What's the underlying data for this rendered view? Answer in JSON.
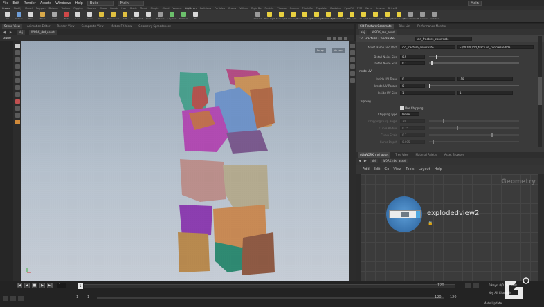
{
  "menu": {
    "items": [
      "File",
      "Edit",
      "Render",
      "Assets",
      "Windows",
      "Help"
    ],
    "desktop": "Build",
    "network": "Main",
    "right_label": "Main"
  },
  "shelf_tabs": [
    "Create",
    "Modify",
    "Model",
    "Polygon",
    "Deform",
    "Texture",
    "Rigging",
    "Muscles",
    "Chara",
    "Constr",
    "Hair",
    "Guide",
    "Terrai",
    "Simple",
    "Cloud",
    "Volume",
    "Lights an",
    "Collisions",
    "Particles",
    "Grains",
    "Vellum",
    "Rigid Bo",
    "Particle",
    "Viscous",
    "Oceans",
    "Flush Co",
    "Populate",
    "Containe",
    "Pyro FX",
    "FEM",
    "Wires",
    "Crowds",
    "Drive Si"
  ],
  "shelf_tools": [
    {
      "label": "Box",
      "color": "#d8d8d8"
    },
    {
      "label": "Sphere",
      "color": "#6f9ed8"
    },
    {
      "label": "Tube",
      "color": "#d8d8d8"
    },
    {
      "label": "Torus",
      "color": "#d9a94a"
    },
    {
      "label": "Grid",
      "color": "#a8a8a8"
    },
    {
      "label": "Null",
      "color": "#d04848"
    },
    {
      "label": "Line",
      "color": "#d8d8d8"
    },
    {
      "label": "Circle",
      "color": "#d8d8d8"
    },
    {
      "label": "Curve",
      "color": "#e0c040"
    },
    {
      "label": "Draw Curve",
      "color": "#e0c040"
    },
    {
      "label": "Path",
      "color": "#e0c040"
    },
    {
      "label": "Spray Paint",
      "color": "#d8d8d8"
    },
    {
      "label": "Font",
      "color": "#d8d8d8"
    },
    {
      "label": "Platonic",
      "color": "#9a9a9a"
    },
    {
      "label": "L-System",
      "color": "#6cc06c"
    },
    {
      "label": "Metaball",
      "color": "#6cc06c"
    },
    {
      "label": "File",
      "color": "#d8d8d8"
    }
  ],
  "light_tools": [
    {
      "label": "Camera",
      "color": "#9a9a9a"
    },
    {
      "label": "Point Light",
      "color": "#e8d040"
    },
    {
      "label": "Spot Light",
      "color": "#e8d040"
    },
    {
      "label": "Area Light",
      "color": "#e8d040"
    },
    {
      "label": "Geometry Light",
      "color": "#e8d040"
    },
    {
      "label": "Volume Light",
      "color": "#e8d040"
    },
    {
      "label": "Distant Light",
      "color": "#e8d040"
    },
    {
      "label": "Environment Light",
      "color": "#e8d040"
    },
    {
      "label": "Sky Light",
      "color": "#e8d040"
    },
    {
      "label": "GI Light",
      "color": "#e8d040"
    },
    {
      "label": "Caustic Light",
      "color": "#e8d040"
    },
    {
      "label": "Portal Light",
      "color": "#e8d040"
    },
    {
      "label": "Ambient Light",
      "color": "#e8d040"
    },
    {
      "label": "Stereo Camera",
      "color": "#9a9a9a"
    },
    {
      "label": "VR Camera",
      "color": "#9a9a9a"
    },
    {
      "label": "Switcher",
      "color": "#9a9a9a"
    }
  ],
  "pane_tabs": [
    "Scene View",
    "Animation Editor",
    "Render View",
    "Composite View",
    "Motion FX View",
    "Geometry Spreadsheet"
  ],
  "path": {
    "root": "obj",
    "node": "WORK_rbd_asset"
  },
  "viewport": {
    "label": "View",
    "camera_btn": "Persp",
    "display_btn": "No cam"
  },
  "parm": {
    "tabs": [
      "Cld Fracture Concreate",
      "Take List",
      "Performance Monitor"
    ],
    "node_type": "Cld Fracture Concreate",
    "node_name": "cld_fracture_concreate",
    "asset_label": "Asset Name and Path",
    "asset_name": "cld_fracture_concreate",
    "asset_path": "E:/WORK/cld_fracture_concreate.hda",
    "rows": [
      {
        "label": "Detail Noise Size",
        "value": "0.5",
        "pos": 0.08
      },
      {
        "label": "Detail Noise Size",
        "value": "0.1",
        "pos": 0.02
      }
    ],
    "inside_uv": "Inside UV",
    "uv_rows": [
      {
        "label": "Inside UV Trans",
        "value": "0",
        "value2": "-18"
      },
      {
        "label": "Inside UV Rotate",
        "value": "0",
        "pos": 0.0
      },
      {
        "label": "Inside UV Size",
        "value": "1",
        "value2": "1"
      }
    ],
    "chipping": "Chipping",
    "use_chipping": "Use Chipping",
    "chip_rows": [
      {
        "label": "Chipping Type",
        "value": "Noise"
      },
      {
        "label": "Chipping Cusp Angle",
        "value": "30"
      },
      {
        "label": "Curve Radius",
        "value": "0.15"
      },
      {
        "label": "Curve Scale",
        "value": "0.7"
      },
      {
        "label": "Curve Depth",
        "value": "0.005"
      }
    ]
  },
  "net": {
    "tabs": [
      "obj/WORK_rbd_asset",
      "Tree View",
      "Material Palette",
      "Asset Browser"
    ],
    "path_root": "obj",
    "path_node": "WORK_rbd_asset",
    "menu": [
      "Add",
      "Edit",
      "Go",
      "View",
      "Tools",
      "Layout",
      "Help"
    ],
    "context": "Geometry",
    "node_name": "explodedview2"
  },
  "timeline": {
    "frame": "1",
    "start": "1",
    "end": "120",
    "range_start": "1",
    "range_end": "120",
    "end2": "120",
    "keys": "0 keys, 0/0 channels",
    "key_all": "Key All Channels",
    "auto_update": "Auto Update"
  },
  "colors": {
    "accent": "#e8a23a",
    "node": "#4fa8e0"
  }
}
